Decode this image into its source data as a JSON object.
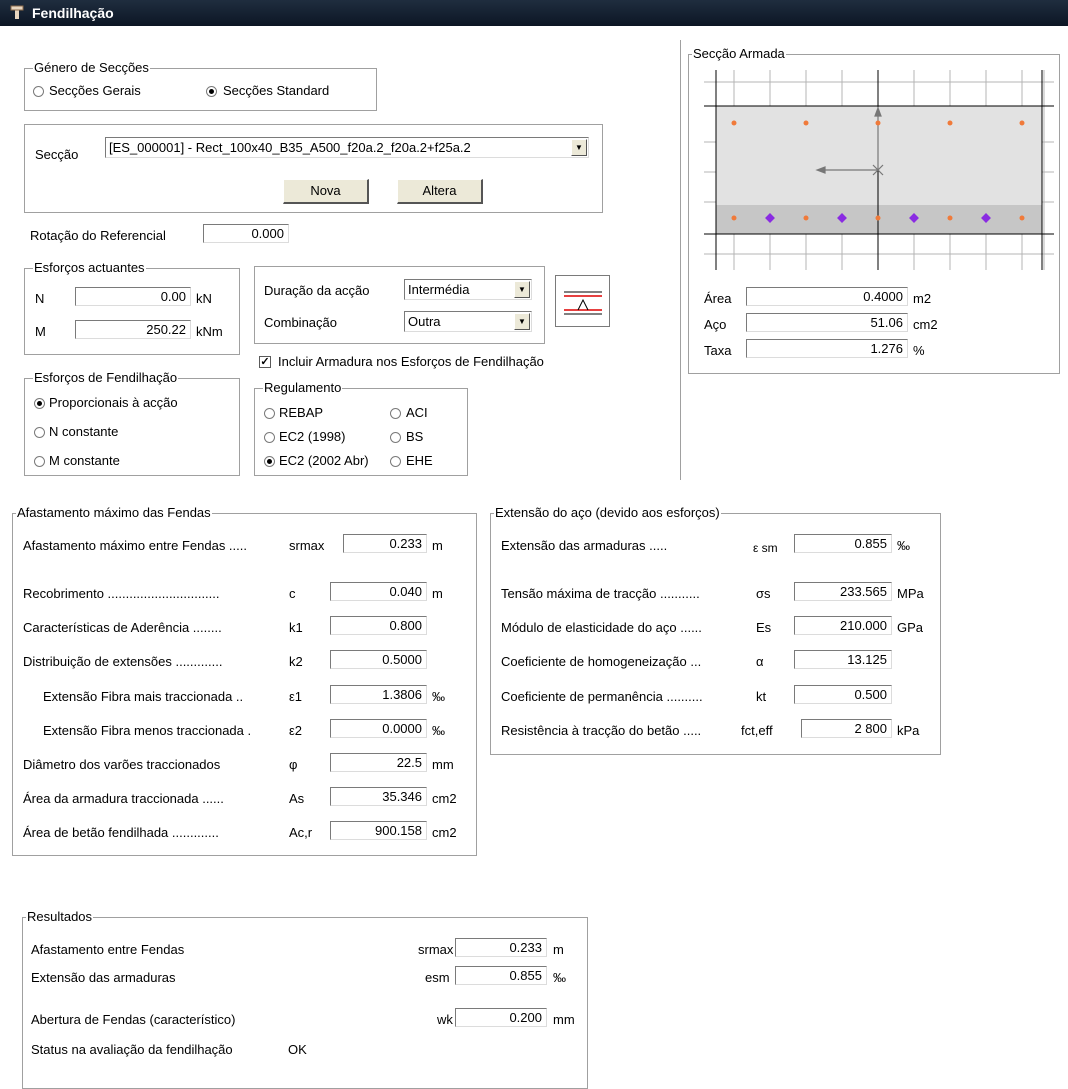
{
  "window": {
    "title": "Fendilhação"
  },
  "genero": {
    "title": "Género de Secções",
    "options": [
      {
        "label": "Secções Gerais",
        "selected": false
      },
      {
        "label": "Secções Standard",
        "selected": true
      }
    ]
  },
  "seccao": {
    "label": "Secção",
    "value": "[ES_000001] - Rect_100x40_B35_A500_f20a.2_f20a.2+f25a.2",
    "nova_label": "Nova",
    "altera_label": "Altera"
  },
  "rotacao": {
    "label": "Rotação do Referencial",
    "value": "0.000"
  },
  "esforcos": {
    "title": "Esforços actuantes",
    "n_label": "N",
    "n_value": "0.00",
    "n_unit": "kN",
    "m_label": "M",
    "m_value": "250.22",
    "m_unit": "kNm"
  },
  "accao": {
    "duracao_label": "Duração da acção",
    "duracao_value": "Intermédia",
    "combinacao_label": "Combinação",
    "combinacao_value": "Outra"
  },
  "incluir": {
    "label": "Incluir Armadura nos Esforços de Fendilhação",
    "checked": true
  },
  "esforcos_fend": {
    "title": "Esforços de Fendilhação",
    "options": [
      {
        "label": "Proporcionais à acção",
        "selected": true
      },
      {
        "label": "N constante",
        "selected": false
      },
      {
        "label": "M constante",
        "selected": false
      }
    ]
  },
  "regulamento": {
    "title": "Regulamento",
    "options": [
      {
        "label": "REBAP",
        "selected": false
      },
      {
        "label": "ACI",
        "selected": false
      },
      {
        "label": "EC2 (1998)",
        "selected": false
      },
      {
        "label": "BS",
        "selected": false
      },
      {
        "label": "EC2 (2002 Abr)",
        "selected": true
      },
      {
        "label": "EHE",
        "selected": false
      }
    ]
  },
  "seccao_armada": {
    "title": "Secção Armada",
    "area_label": "Área",
    "area_value": "0.4000",
    "area_unit": "m2",
    "aco_label": "Aço",
    "aco_value": "51.06",
    "aco_unit": "cm2",
    "taxa_label": "Taxa",
    "taxa_value": "1.276",
    "taxa_unit": "%"
  },
  "afastamento": {
    "title": "Afastamento máximo das Fendas",
    "rows": [
      {
        "label": "Afastamento máximo entre Fendas .....",
        "sym": "srmax",
        "value": "0.233",
        "unit": "m"
      },
      {
        "label": "Recobrimento ...............................",
        "sym": "c",
        "value": "0.040",
        "unit": "m"
      },
      {
        "label": "Características de Aderência ........",
        "sym": "k1",
        "value": "0.800",
        "unit": ""
      },
      {
        "label": "Distribuição de extensões .............",
        "sym": "k2",
        "value": "0.5000",
        "unit": ""
      },
      {
        "label": "Extensão Fibra mais traccionada ..",
        "sym": "ε1",
        "value": "1.3806",
        "unit": "‰"
      },
      {
        "label": "Extensão Fibra menos traccionada .",
        "sym": "ε2",
        "value": "0.0000",
        "unit": "‰"
      },
      {
        "label": "Diâmetro dos varões traccionados",
        "sym": "φ",
        "value": "22.5",
        "unit": "mm"
      },
      {
        "label": "Área da armadura traccionada ......",
        "sym": "As",
        "value": "35.346",
        "unit": "cm2"
      },
      {
        "label": "Área de betão fendilhada .............",
        "sym": "Ac,r",
        "value": "900.158",
        "unit": "cm2"
      }
    ]
  },
  "extensao": {
    "title": "Extensão do aço (devido aos esforços)",
    "rows": [
      {
        "label": "Extensão das armaduras .....",
        "sym": "ε sm",
        "value": "0.855",
        "unit": "‰"
      },
      {
        "label": "Tensão máxima de tracção ...........",
        "sym": "σs",
        "value": "233.565",
        "unit": "MPa"
      },
      {
        "label": "Módulo de elasticidade do aço ......",
        "sym": "Es",
        "value": "210.000",
        "unit": "GPa"
      },
      {
        "label": "Coeficiente de homogeneização ...",
        "sym": "α",
        "value": "13.125",
        "unit": ""
      },
      {
        "label": "Coeficiente de permanência ..........",
        "sym": "kt",
        "value": "0.500",
        "unit": ""
      },
      {
        "label": "Resistência à tracção do betão .....",
        "sym": "fct,eff",
        "value": "2 800",
        "unit": "kPa"
      }
    ]
  },
  "resultados": {
    "title": "Resultados",
    "rows": [
      {
        "label": "Afastamento entre Fendas",
        "sym": "srmax",
        "value": "0.233",
        "unit": "m"
      },
      {
        "label": "Extensão das armaduras",
        "sym": "esm",
        "value": "0.855",
        "unit": "‰"
      },
      {
        "label": "Abertura de Fendas (característico)",
        "sym": "wk",
        "value": "0.200",
        "unit": "mm"
      }
    ],
    "status_label": "Status na avaliação da fendilhação",
    "status_value": "OK"
  },
  "colors": {
    "concrete": "#e0e0e0",
    "tension_zone": "#c8c8c8",
    "bar_orange": "#f07a3a",
    "bar_purple": "#8a2be2"
  }
}
